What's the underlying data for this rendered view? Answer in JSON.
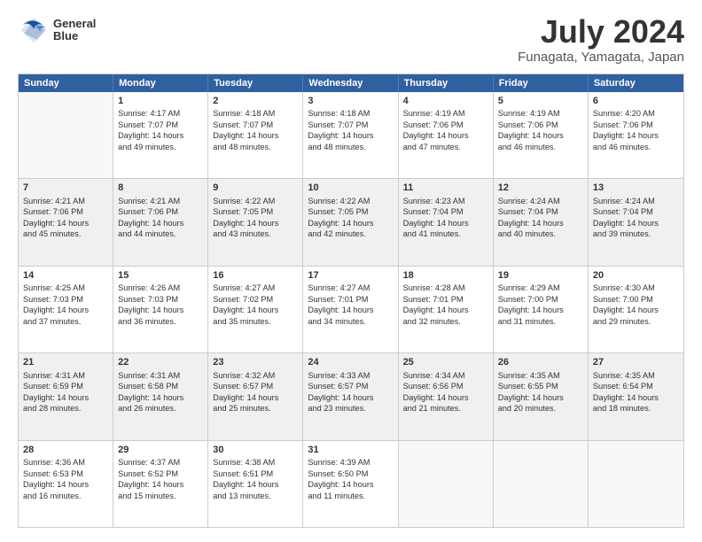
{
  "logo": {
    "line1": "General",
    "line2": "Blue"
  },
  "title": "July 2024",
  "subtitle": "Funagata, Yamagata, Japan",
  "header_days": [
    "Sunday",
    "Monday",
    "Tuesday",
    "Wednesday",
    "Thursday",
    "Friday",
    "Saturday"
  ],
  "rows": [
    [
      {
        "day": "",
        "info": "",
        "shaded": false,
        "empty": true
      },
      {
        "day": "1",
        "info": "Sunrise: 4:17 AM\nSunset: 7:07 PM\nDaylight: 14 hours\nand 49 minutes.",
        "shaded": false,
        "empty": false
      },
      {
        "day": "2",
        "info": "Sunrise: 4:18 AM\nSunset: 7:07 PM\nDaylight: 14 hours\nand 48 minutes.",
        "shaded": false,
        "empty": false
      },
      {
        "day": "3",
        "info": "Sunrise: 4:18 AM\nSunset: 7:07 PM\nDaylight: 14 hours\nand 48 minutes.",
        "shaded": false,
        "empty": false
      },
      {
        "day": "4",
        "info": "Sunrise: 4:19 AM\nSunset: 7:06 PM\nDaylight: 14 hours\nand 47 minutes.",
        "shaded": false,
        "empty": false
      },
      {
        "day": "5",
        "info": "Sunrise: 4:19 AM\nSunset: 7:06 PM\nDaylight: 14 hours\nand 46 minutes.",
        "shaded": false,
        "empty": false
      },
      {
        "day": "6",
        "info": "Sunrise: 4:20 AM\nSunset: 7:06 PM\nDaylight: 14 hours\nand 46 minutes.",
        "shaded": false,
        "empty": false
      }
    ],
    [
      {
        "day": "7",
        "info": "Sunrise: 4:21 AM\nSunset: 7:06 PM\nDaylight: 14 hours\nand 45 minutes.",
        "shaded": true,
        "empty": false
      },
      {
        "day": "8",
        "info": "Sunrise: 4:21 AM\nSunset: 7:06 PM\nDaylight: 14 hours\nand 44 minutes.",
        "shaded": true,
        "empty": false
      },
      {
        "day": "9",
        "info": "Sunrise: 4:22 AM\nSunset: 7:05 PM\nDaylight: 14 hours\nand 43 minutes.",
        "shaded": true,
        "empty": false
      },
      {
        "day": "10",
        "info": "Sunrise: 4:22 AM\nSunset: 7:05 PM\nDaylight: 14 hours\nand 42 minutes.",
        "shaded": true,
        "empty": false
      },
      {
        "day": "11",
        "info": "Sunrise: 4:23 AM\nSunset: 7:04 PM\nDaylight: 14 hours\nand 41 minutes.",
        "shaded": true,
        "empty": false
      },
      {
        "day": "12",
        "info": "Sunrise: 4:24 AM\nSunset: 7:04 PM\nDaylight: 14 hours\nand 40 minutes.",
        "shaded": true,
        "empty": false
      },
      {
        "day": "13",
        "info": "Sunrise: 4:24 AM\nSunset: 7:04 PM\nDaylight: 14 hours\nand 39 minutes.",
        "shaded": true,
        "empty": false
      }
    ],
    [
      {
        "day": "14",
        "info": "Sunrise: 4:25 AM\nSunset: 7:03 PM\nDaylight: 14 hours\nand 37 minutes.",
        "shaded": false,
        "empty": false
      },
      {
        "day": "15",
        "info": "Sunrise: 4:26 AM\nSunset: 7:03 PM\nDaylight: 14 hours\nand 36 minutes.",
        "shaded": false,
        "empty": false
      },
      {
        "day": "16",
        "info": "Sunrise: 4:27 AM\nSunset: 7:02 PM\nDaylight: 14 hours\nand 35 minutes.",
        "shaded": false,
        "empty": false
      },
      {
        "day": "17",
        "info": "Sunrise: 4:27 AM\nSunset: 7:01 PM\nDaylight: 14 hours\nand 34 minutes.",
        "shaded": false,
        "empty": false
      },
      {
        "day": "18",
        "info": "Sunrise: 4:28 AM\nSunset: 7:01 PM\nDaylight: 14 hours\nand 32 minutes.",
        "shaded": false,
        "empty": false
      },
      {
        "day": "19",
        "info": "Sunrise: 4:29 AM\nSunset: 7:00 PM\nDaylight: 14 hours\nand 31 minutes.",
        "shaded": false,
        "empty": false
      },
      {
        "day": "20",
        "info": "Sunrise: 4:30 AM\nSunset: 7:00 PM\nDaylight: 14 hours\nand 29 minutes.",
        "shaded": false,
        "empty": false
      }
    ],
    [
      {
        "day": "21",
        "info": "Sunrise: 4:31 AM\nSunset: 6:59 PM\nDaylight: 14 hours\nand 28 minutes.",
        "shaded": true,
        "empty": false
      },
      {
        "day": "22",
        "info": "Sunrise: 4:31 AM\nSunset: 6:58 PM\nDaylight: 14 hours\nand 26 minutes.",
        "shaded": true,
        "empty": false
      },
      {
        "day": "23",
        "info": "Sunrise: 4:32 AM\nSunset: 6:57 PM\nDaylight: 14 hours\nand 25 minutes.",
        "shaded": true,
        "empty": false
      },
      {
        "day": "24",
        "info": "Sunrise: 4:33 AM\nSunset: 6:57 PM\nDaylight: 14 hours\nand 23 minutes.",
        "shaded": true,
        "empty": false
      },
      {
        "day": "25",
        "info": "Sunrise: 4:34 AM\nSunset: 6:56 PM\nDaylight: 14 hours\nand 21 minutes.",
        "shaded": true,
        "empty": false
      },
      {
        "day": "26",
        "info": "Sunrise: 4:35 AM\nSunset: 6:55 PM\nDaylight: 14 hours\nand 20 minutes.",
        "shaded": true,
        "empty": false
      },
      {
        "day": "27",
        "info": "Sunrise: 4:35 AM\nSunset: 6:54 PM\nDaylight: 14 hours\nand 18 minutes.",
        "shaded": true,
        "empty": false
      }
    ],
    [
      {
        "day": "28",
        "info": "Sunrise: 4:36 AM\nSunset: 6:53 PM\nDaylight: 14 hours\nand 16 minutes.",
        "shaded": false,
        "empty": false
      },
      {
        "day": "29",
        "info": "Sunrise: 4:37 AM\nSunset: 6:52 PM\nDaylight: 14 hours\nand 15 minutes.",
        "shaded": false,
        "empty": false
      },
      {
        "day": "30",
        "info": "Sunrise: 4:38 AM\nSunset: 6:51 PM\nDaylight: 14 hours\nand 13 minutes.",
        "shaded": false,
        "empty": false
      },
      {
        "day": "31",
        "info": "Sunrise: 4:39 AM\nSunset: 6:50 PM\nDaylight: 14 hours\nand 11 minutes.",
        "shaded": false,
        "empty": false
      },
      {
        "day": "",
        "info": "",
        "shaded": false,
        "empty": true
      },
      {
        "day": "",
        "info": "",
        "shaded": false,
        "empty": true
      },
      {
        "day": "",
        "info": "",
        "shaded": false,
        "empty": true
      }
    ]
  ]
}
